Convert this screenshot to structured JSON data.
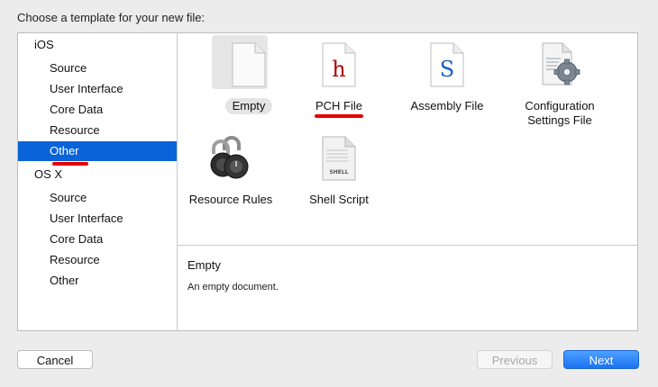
{
  "dialog": {
    "title": "Choose a template for your new file:"
  },
  "sidebar": {
    "items": [
      {
        "label": "iOS",
        "kind": "group"
      },
      {
        "label": "Source",
        "kind": "child"
      },
      {
        "label": "User Interface",
        "kind": "child"
      },
      {
        "label": "Core Data",
        "kind": "child"
      },
      {
        "label": "Resource",
        "kind": "child"
      },
      {
        "label": "Other",
        "kind": "child",
        "selected": true
      },
      {
        "label": "OS X",
        "kind": "group"
      },
      {
        "label": "Source",
        "kind": "child"
      },
      {
        "label": "User Interface",
        "kind": "child"
      },
      {
        "label": "Core Data",
        "kind": "child"
      },
      {
        "label": "Resource",
        "kind": "child"
      },
      {
        "label": "Other",
        "kind": "child"
      }
    ]
  },
  "templates": [
    {
      "label": "Empty",
      "icon": "empty-document-icon",
      "selected": true
    },
    {
      "label": "PCH File",
      "icon": "pch-file-icon",
      "glyph": "h"
    },
    {
      "label": "Assembly File",
      "icon": "assembly-file-icon",
      "glyph": "S"
    },
    {
      "label": "Configuration Settings File",
      "icon": "gear-document-icon"
    },
    {
      "label": "Resource Rules",
      "icon": "padlock-icon"
    },
    {
      "label": "Shell Script",
      "icon": "shell-script-icon",
      "glyph": "SHELL"
    }
  ],
  "description": {
    "title": "Empty",
    "text": "An empty document."
  },
  "buttons": {
    "cancel": "Cancel",
    "previous": "Previous",
    "next": "Next"
  },
  "colors": {
    "selection": "#0b63d9",
    "annotation_red": "#e60000",
    "glyph_red": "#b00000",
    "glyph_blue": "#1a5fc8",
    "primary_button": "#1a73f0"
  }
}
